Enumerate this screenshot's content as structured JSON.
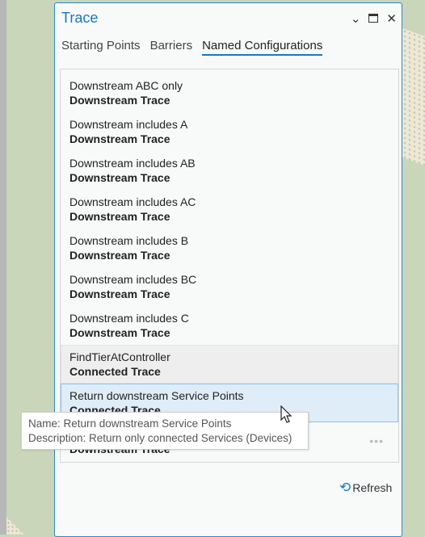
{
  "panel": {
    "title": "Trace",
    "controls": {
      "menu": "⌄",
      "maximize": "🗖",
      "close": "✕"
    }
  },
  "tabs": [
    {
      "label": "Starting Points"
    },
    {
      "label": "Barriers"
    },
    {
      "label": "Named Configurations",
      "active": true
    }
  ],
  "items": [
    {
      "name": "Downstream ABC only",
      "type": "Downstream Trace"
    },
    {
      "name": "Downstream includes A",
      "type": "Downstream Trace"
    },
    {
      "name": "Downstream includes AB",
      "type": "Downstream Trace"
    },
    {
      "name": "Downstream includes AC",
      "type": "Downstream Trace"
    },
    {
      "name": "Downstream includes B",
      "type": "Downstream Trace"
    },
    {
      "name": "Downstream includes BC",
      "type": "Downstream Trace"
    },
    {
      "name": "Downstream includes C",
      "type": "Downstream Trace"
    },
    {
      "name": "FindTierAtController",
      "type": "Connected Trace",
      "state": "hover"
    },
    {
      "name": "Return downstream Service Points",
      "type": "Connected Trace",
      "state": "selected"
    },
    {
      "name": "",
      "type": "Downstream Trace"
    }
  ],
  "more_label": "•••",
  "tooltip": {
    "name": "Name: Return downstream Service Points",
    "description": "Description: Return only connected Services (Devices)"
  },
  "refresh": {
    "icon": "refresh-icon",
    "label": "Refresh",
    "glyph": "⟲"
  },
  "colors": {
    "accent": "#1b78c2",
    "selected": "#deedf8",
    "background": "#c9d6ba"
  }
}
